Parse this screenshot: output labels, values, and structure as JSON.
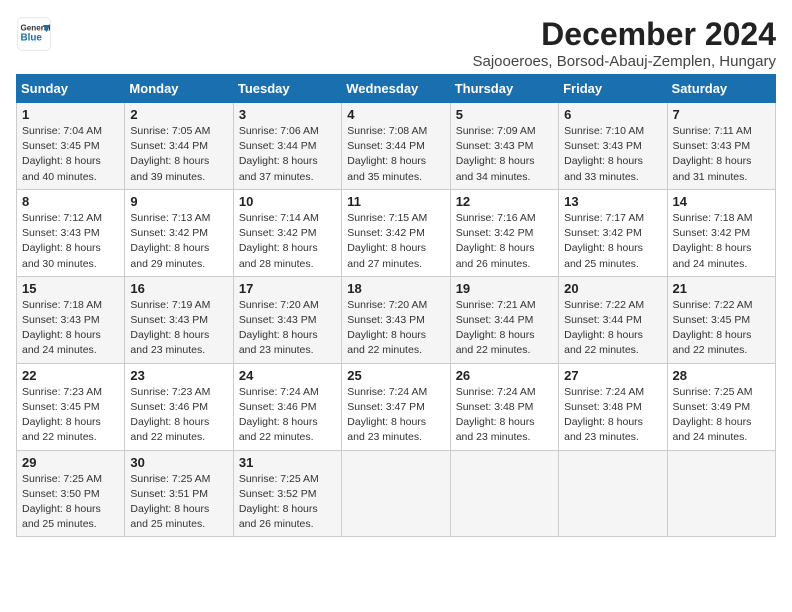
{
  "header": {
    "logo_line1": "General",
    "logo_line2": "Blue",
    "title": "December 2024",
    "subtitle": "Sajooeroes, Borsod-Abauj-Zemplen, Hungary"
  },
  "weekdays": [
    "Sunday",
    "Monday",
    "Tuesday",
    "Wednesday",
    "Thursday",
    "Friday",
    "Saturday"
  ],
  "weeks": [
    [
      {
        "day": 1,
        "sunrise": "7:04 AM",
        "sunset": "3:45 PM",
        "daylight": "8 hours and 40 minutes."
      },
      {
        "day": 2,
        "sunrise": "7:05 AM",
        "sunset": "3:44 PM",
        "daylight": "8 hours and 39 minutes."
      },
      {
        "day": 3,
        "sunrise": "7:06 AM",
        "sunset": "3:44 PM",
        "daylight": "8 hours and 37 minutes."
      },
      {
        "day": 4,
        "sunrise": "7:08 AM",
        "sunset": "3:44 PM",
        "daylight": "8 hours and 35 minutes."
      },
      {
        "day": 5,
        "sunrise": "7:09 AM",
        "sunset": "3:43 PM",
        "daylight": "8 hours and 34 minutes."
      },
      {
        "day": 6,
        "sunrise": "7:10 AM",
        "sunset": "3:43 PM",
        "daylight": "8 hours and 33 minutes."
      },
      {
        "day": 7,
        "sunrise": "7:11 AM",
        "sunset": "3:43 PM",
        "daylight": "8 hours and 31 minutes."
      }
    ],
    [
      {
        "day": 8,
        "sunrise": "7:12 AM",
        "sunset": "3:43 PM",
        "daylight": "8 hours and 30 minutes."
      },
      {
        "day": 9,
        "sunrise": "7:13 AM",
        "sunset": "3:42 PM",
        "daylight": "8 hours and 29 minutes."
      },
      {
        "day": 10,
        "sunrise": "7:14 AM",
        "sunset": "3:42 PM",
        "daylight": "8 hours and 28 minutes."
      },
      {
        "day": 11,
        "sunrise": "7:15 AM",
        "sunset": "3:42 PM",
        "daylight": "8 hours and 27 minutes."
      },
      {
        "day": 12,
        "sunrise": "7:16 AM",
        "sunset": "3:42 PM",
        "daylight": "8 hours and 26 minutes."
      },
      {
        "day": 13,
        "sunrise": "7:17 AM",
        "sunset": "3:42 PM",
        "daylight": "8 hours and 25 minutes."
      },
      {
        "day": 14,
        "sunrise": "7:18 AM",
        "sunset": "3:42 PM",
        "daylight": "8 hours and 24 minutes."
      }
    ],
    [
      {
        "day": 15,
        "sunrise": "7:18 AM",
        "sunset": "3:43 PM",
        "daylight": "8 hours and 24 minutes."
      },
      {
        "day": 16,
        "sunrise": "7:19 AM",
        "sunset": "3:43 PM",
        "daylight": "8 hours and 23 minutes."
      },
      {
        "day": 17,
        "sunrise": "7:20 AM",
        "sunset": "3:43 PM",
        "daylight": "8 hours and 23 minutes."
      },
      {
        "day": 18,
        "sunrise": "7:20 AM",
        "sunset": "3:43 PM",
        "daylight": "8 hours and 22 minutes."
      },
      {
        "day": 19,
        "sunrise": "7:21 AM",
        "sunset": "3:44 PM",
        "daylight": "8 hours and 22 minutes."
      },
      {
        "day": 20,
        "sunrise": "7:22 AM",
        "sunset": "3:44 PM",
        "daylight": "8 hours and 22 minutes."
      },
      {
        "day": 21,
        "sunrise": "7:22 AM",
        "sunset": "3:45 PM",
        "daylight": "8 hours and 22 minutes."
      }
    ],
    [
      {
        "day": 22,
        "sunrise": "7:23 AM",
        "sunset": "3:45 PM",
        "daylight": "8 hours and 22 minutes."
      },
      {
        "day": 23,
        "sunrise": "7:23 AM",
        "sunset": "3:46 PM",
        "daylight": "8 hours and 22 minutes."
      },
      {
        "day": 24,
        "sunrise": "7:24 AM",
        "sunset": "3:46 PM",
        "daylight": "8 hours and 22 minutes."
      },
      {
        "day": 25,
        "sunrise": "7:24 AM",
        "sunset": "3:47 PM",
        "daylight": "8 hours and 23 minutes."
      },
      {
        "day": 26,
        "sunrise": "7:24 AM",
        "sunset": "3:48 PM",
        "daylight": "8 hours and 23 minutes."
      },
      {
        "day": 27,
        "sunrise": "7:24 AM",
        "sunset": "3:48 PM",
        "daylight": "8 hours and 23 minutes."
      },
      {
        "day": 28,
        "sunrise": "7:25 AM",
        "sunset": "3:49 PM",
        "daylight": "8 hours and 24 minutes."
      }
    ],
    [
      {
        "day": 29,
        "sunrise": "7:25 AM",
        "sunset": "3:50 PM",
        "daylight": "8 hours and 25 minutes."
      },
      {
        "day": 30,
        "sunrise": "7:25 AM",
        "sunset": "3:51 PM",
        "daylight": "8 hours and 25 minutes."
      },
      {
        "day": 31,
        "sunrise": "7:25 AM",
        "sunset": "3:52 PM",
        "daylight": "8 hours and 26 minutes."
      },
      null,
      null,
      null,
      null
    ]
  ]
}
